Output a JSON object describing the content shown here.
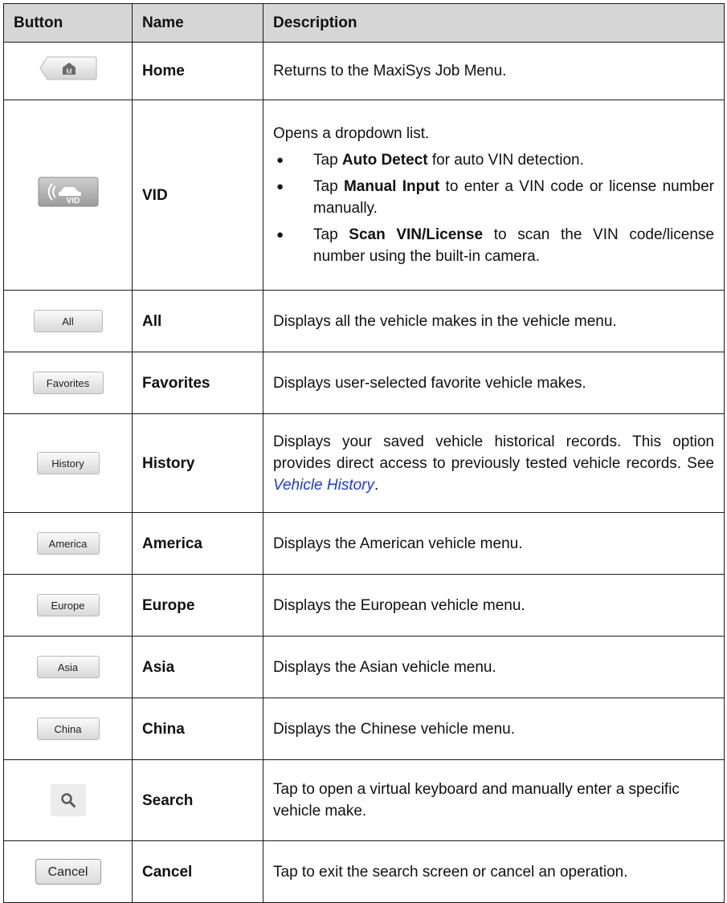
{
  "header": {
    "col_button": "Button",
    "col_name": "Name",
    "col_description": "Description"
  },
  "rows": {
    "home": {
      "name": "Home",
      "description": "Returns to the MaxiSys Job Menu.",
      "icon": "home-m-icon",
      "icon_text": "M"
    },
    "vid": {
      "name": "VID",
      "icon": "vid-car-icon",
      "icon_text": "VID",
      "intro": "Opens a dropdown list.",
      "bullets": [
        {
          "pre": "Tap ",
          "bold": "Auto Detect",
          "post": " for auto VIN detection."
        },
        {
          "pre": "Tap ",
          "bold": "Manual Input",
          "post": " to enter a VIN code or license number manually."
        },
        {
          "pre": "Tap ",
          "bold": "Scan VIN/License",
          "post": " to scan the VIN code/license number using the built-in camera."
        }
      ]
    },
    "all": {
      "button_label": "All",
      "name": "All",
      "description": "Displays all the vehicle makes in the vehicle menu."
    },
    "favorites": {
      "button_label": "Favorites",
      "name": "Favorites",
      "description": "Displays user-selected favorite vehicle makes."
    },
    "history": {
      "button_label": "History",
      "name": "History",
      "description_pre": "Displays your saved vehicle historical records. This option provides direct access to previously tested vehicle records. See ",
      "link_text": "Vehicle History",
      "description_post": "."
    },
    "america": {
      "button_label": "America",
      "name": "America",
      "description": "Displays the American vehicle menu."
    },
    "europe": {
      "button_label": "Europe",
      "name": "Europe",
      "description": "Displays the European vehicle menu."
    },
    "asia": {
      "button_label": "Asia",
      "name": "Asia",
      "description": "Displays the Asian vehicle menu."
    },
    "china": {
      "button_label": "China",
      "name": "China",
      "description": "Displays the Chinese vehicle menu."
    },
    "search": {
      "icon": "search-icon",
      "name": "Search",
      "description": "Tap to open a virtual keyboard and manually enter a specific vehicle make."
    },
    "cancel": {
      "button_label": "Cancel",
      "name": "Cancel",
      "description": "Tap to exit the search screen or cancel an operation."
    }
  },
  "colors": {
    "header_bg": "#d6d6d6",
    "link": "#1a3ae0",
    "border": "#1a1a1a"
  }
}
